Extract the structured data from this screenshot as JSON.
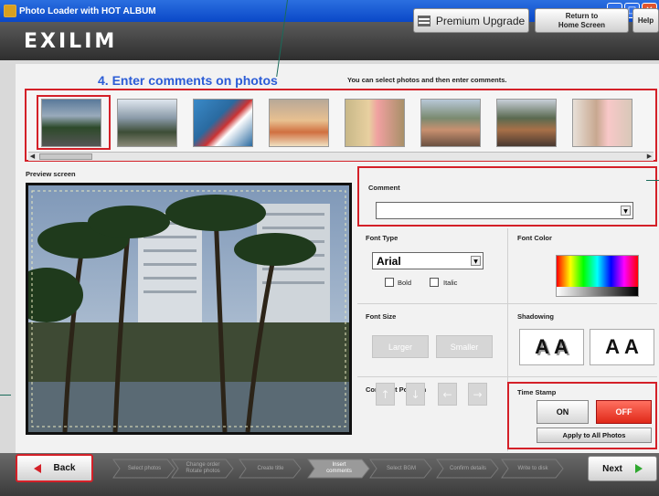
{
  "window": {
    "title": "Photo Loader with HOT ALBUM"
  },
  "header": {
    "logo": "EXILIM",
    "premium_label": "Premium Upgrade",
    "home_label_1": "Return to",
    "home_label_2": "Home Screen",
    "help_label": "Help"
  },
  "step": {
    "title": "4. Enter comments on photos",
    "hint": "You can select photos and then enter comments."
  },
  "thumbnails": [
    {
      "name": "beach-trees"
    },
    {
      "name": "palm-crowd"
    },
    {
      "name": "kids-pool"
    },
    {
      "name": "kid-eating"
    },
    {
      "name": "kid-sitting"
    },
    {
      "name": "family-dining"
    },
    {
      "name": "shop-scene"
    },
    {
      "name": "girl-portrait"
    }
  ],
  "preview": {
    "label": "Preview screen"
  },
  "comment": {
    "label": "Comment",
    "value": ""
  },
  "font_type": {
    "label": "Font Type",
    "selected": "Arial",
    "bold_label": "Bold",
    "italic_label": "Italic"
  },
  "font_color": {
    "label": "Font Color"
  },
  "font_size": {
    "label": "Font Size",
    "larger_label": "Larger",
    "smaller_label": "Smaller"
  },
  "shadowing": {
    "label": "Shadowing",
    "glyph": "A"
  },
  "comment_position": {
    "label": "Comment Position"
  },
  "time_stamp": {
    "label": "Time Stamp",
    "on_label": "ON",
    "off_label": "OFF",
    "apply_label": "Apply to All Photos"
  },
  "footer": {
    "back_label": "Back",
    "next_label": "Next",
    "steps": [
      {
        "l1": "Select photos",
        "l2": ""
      },
      {
        "l1": "Change order",
        "l2": "Rotate photos"
      },
      {
        "l1": "Create title",
        "l2": ""
      },
      {
        "l1": "Insert",
        "l2": "comments"
      },
      {
        "l1": "Select BGM",
        "l2": ""
      },
      {
        "l1": "Confirm details",
        "l2": ""
      },
      {
        "l1": "Write to disk",
        "l2": ""
      }
    ]
  },
  "colors": {
    "accent_red": "#d42028",
    "title_blue": "#2b5cd6",
    "off_red": "#e02818",
    "next_green": "#2fa82f"
  }
}
